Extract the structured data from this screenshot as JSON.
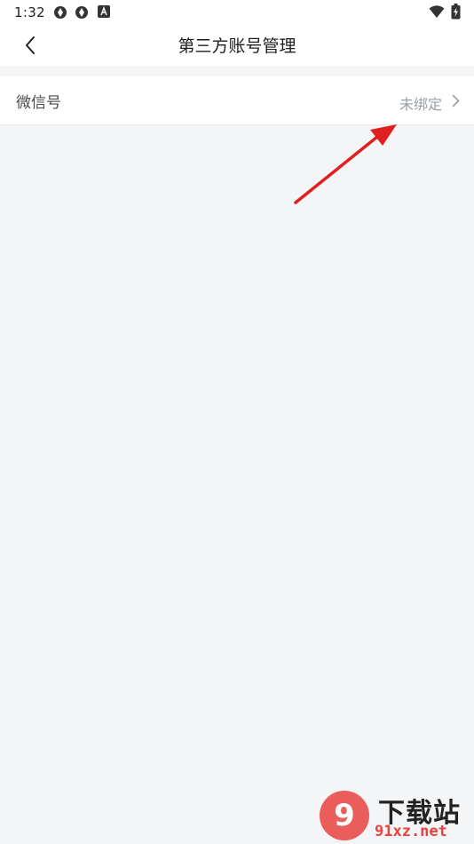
{
  "status_bar": {
    "time": "1:32",
    "icons_left": [
      "vpn-icon",
      "vpn-icon",
      "a-app-icon"
    ],
    "icons_right": [
      "wifi-icon",
      "battery-charging-icon"
    ]
  },
  "header": {
    "title": "第三方账号管理",
    "back_icon": "chevron-left-icon"
  },
  "accounts": [
    {
      "label": "微信号",
      "status": "未绑定",
      "icon": "chevron-right-icon"
    }
  ],
  "annotation": {
    "color": "#e02020",
    "icon": "red-arrow"
  },
  "watermark": {
    "logo_text": "9",
    "title": "下载站",
    "domain": "91xz.net",
    "brand_color": "#e8433f"
  }
}
